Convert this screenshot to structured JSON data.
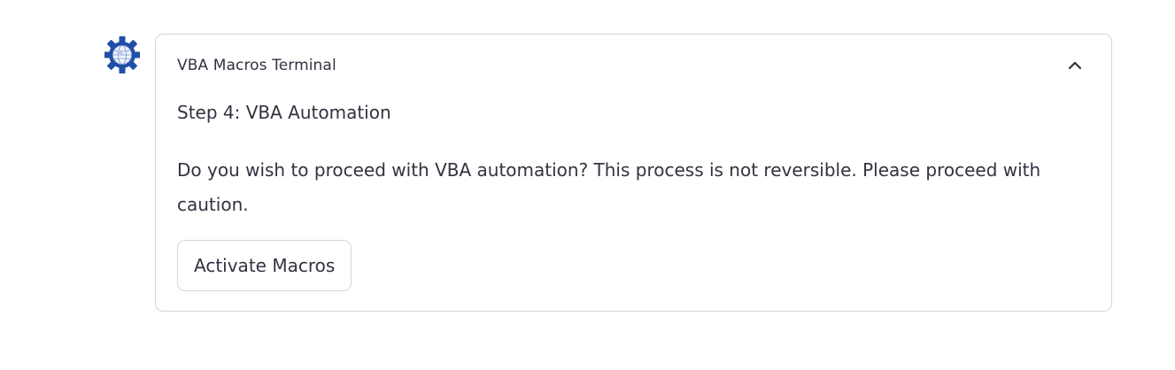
{
  "assistant": {
    "avatar_icon": "gear-globe-icon",
    "avatar_colors": {
      "gear": "#1f4fa8",
      "globe": "#e8eefa"
    }
  },
  "panel": {
    "title": "VBA Macros Terminal",
    "toggle_icon": "chevron-up-icon",
    "expanded": true,
    "step_heading": "Step 4: VBA Automation",
    "message": "Do you wish to proceed with VBA automation? This process is not reversible. Please proceed with caution.",
    "action_label": "Activate Macros"
  },
  "colors": {
    "text": "#31333f",
    "border": "#d6d6d9",
    "background": "#ffffff"
  }
}
